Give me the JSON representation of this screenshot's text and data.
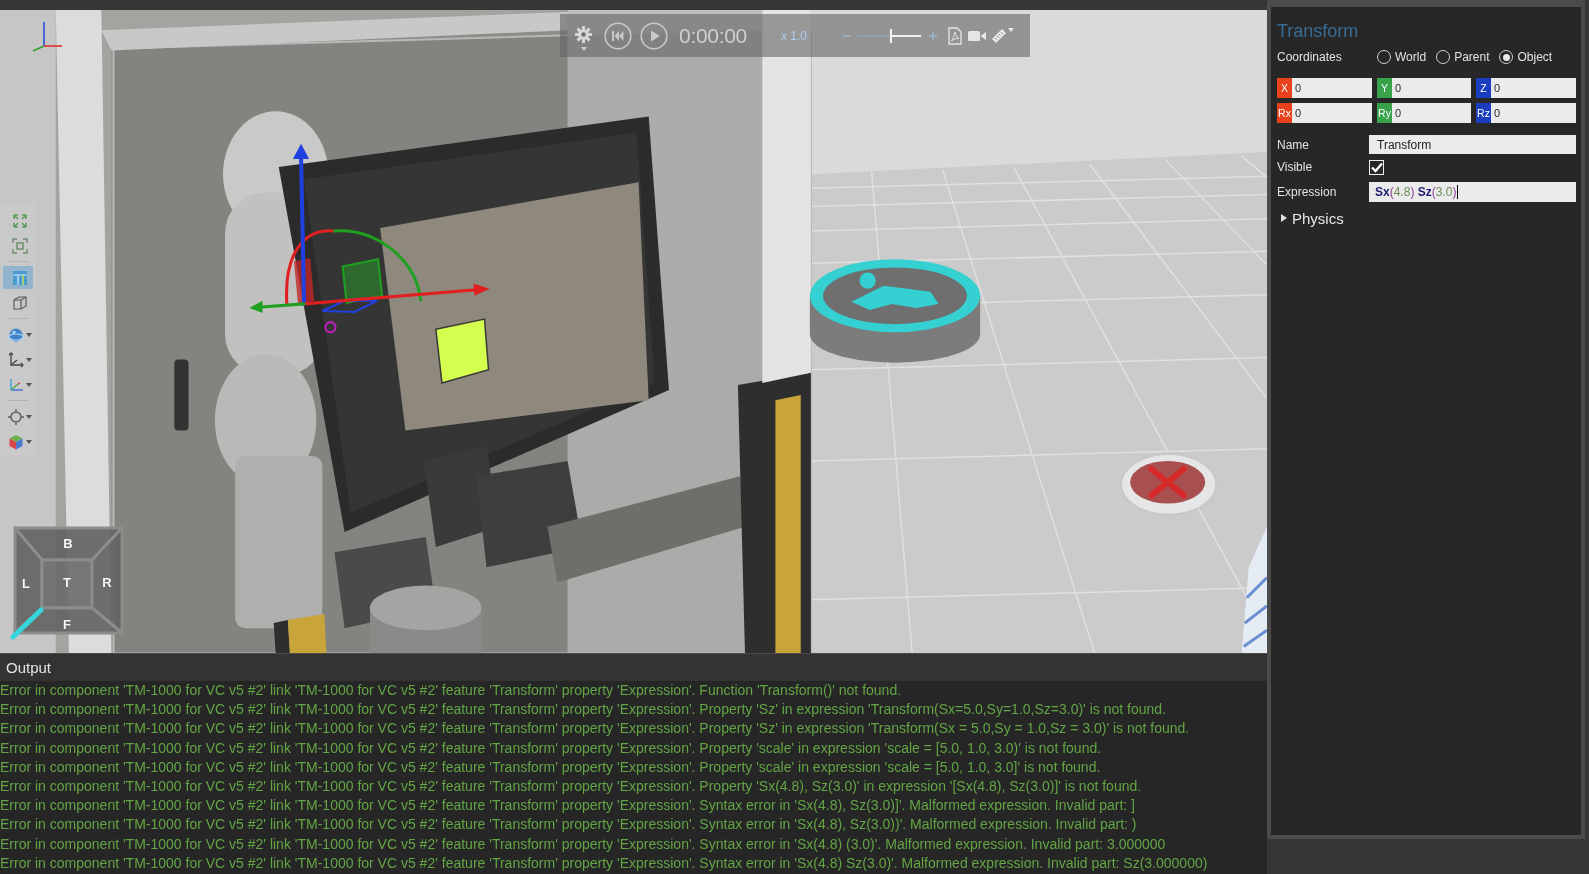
{
  "viewport": {
    "playback_toolbar": {
      "time": "0:00:00",
      "speed": "x 1.0",
      "zoom_slider": {
        "level": 0.53
      }
    },
    "view_toolbar": {
      "groups": [
        {
          "tools": [
            {
              "kind": "fitall",
              "selected": false,
              "has_menu": false
            },
            {
              "kind": "fitframe",
              "selected": false,
              "has_menu": false
            }
          ]
        },
        {
          "tools": [
            {
              "kind": "layout",
              "selected": true,
              "has_menu": false
            },
            {
              "kind": "wireframe",
              "selected": false,
              "has_menu": false
            }
          ]
        },
        {
          "tools": [
            {
              "kind": "sphere",
              "selected": false,
              "has_menu": true
            },
            {
              "kind": "axes",
              "selected": false,
              "has_menu": true
            },
            {
              "kind": "coloraxes",
              "selected": false,
              "has_menu": true
            }
          ]
        },
        {
          "tools": [
            {
              "kind": "snap",
              "selected": false,
              "has_menu": true
            },
            {
              "kind": "cube",
              "selected": false,
              "has_menu": true
            }
          ]
        }
      ]
    },
    "view_cube": {
      "faces": [
        {
          "kind": "upper",
          "label": "B"
        },
        {
          "kind": "left",
          "label": "L"
        },
        {
          "kind": "center",
          "label": "T"
        },
        {
          "kind": "right",
          "label": "R"
        },
        {
          "kind": "lower",
          "label": "F"
        }
      ]
    }
  },
  "properties_panel": {
    "title": "Transform",
    "coordinates": {
      "label": "Coordinates",
      "options": [
        {
          "label": "World",
          "selected": false
        },
        {
          "label": "Parent",
          "selected": false
        },
        {
          "label": "Object",
          "selected": true
        }
      ]
    },
    "position_fields": [
      {
        "label": "X",
        "value": "0",
        "color": "#e8421c"
      },
      {
        "label": "Y",
        "value": "0",
        "color": "#38a34a"
      },
      {
        "label": "Z",
        "value": "0",
        "color": "#1b3ec0"
      }
    ],
    "rotation_fields": [
      {
        "label": "Rx",
        "value": "0",
        "color": "#e8421c"
      },
      {
        "label": "Ry",
        "value": "0",
        "color": "#38a34a"
      },
      {
        "label": "Rz",
        "value": "0",
        "color": "#1b3ec0"
      }
    ],
    "name": {
      "label": "Name",
      "value": "Transform"
    },
    "visible": {
      "label": "Visible",
      "checked": true
    },
    "expression": {
      "label": "Expression",
      "focused": true,
      "tokens": [
        {
          "kind": "name",
          "text": "Sx"
        },
        {
          "kind": "paren",
          "text": "("
        },
        {
          "kind": "number",
          "text": "4.8"
        },
        {
          "kind": "paren",
          "text": ") "
        },
        {
          "kind": "name",
          "text": "Sz"
        },
        {
          "kind": "paren",
          "text": "("
        },
        {
          "kind": "number",
          "text": "3.0"
        },
        {
          "kind": "paren",
          "text": ")"
        }
      ]
    },
    "sections": [
      {
        "label": "Physics",
        "expanded": false
      }
    ]
  },
  "output": {
    "title": "Output",
    "lines": [
      "Error in component 'TM-1000 for VC v5 #2' link 'TM-1000 for VC v5 #2' feature 'Transform' property 'Expression'. Function 'Transform()' not found.",
      "Error in component 'TM-1000 for VC v5 #2' link 'TM-1000 for VC v5 #2' feature 'Transform' property 'Expression'. Property 'Sz' in expression 'Transform(Sx=5.0,Sy=1.0,Sz=3.0)' is not found.",
      "Error in component 'TM-1000 for VC v5 #2' link 'TM-1000 for VC v5 #2' feature 'Transform' property 'Expression'. Property 'Sz' in expression 'Transform(Sx = 5.0,Sy = 1.0,Sz = 3.0)' is not found.",
      "Error in component 'TM-1000 for VC v5 #2' link 'TM-1000 for VC v5 #2' feature 'Transform' property 'Expression'. Property 'scale' in expression 'scale = [5.0, 1.0, 3.0)' is not found.",
      "Error in component 'TM-1000 for VC v5 #2' link 'TM-1000 for VC v5 #2' feature 'Transform' property 'Expression'. Property 'scale' in expression 'scale = [5.0, 1.0, 3.0]' is not found.",
      "Error in component 'TM-1000 for VC v5 #2' link 'TM-1000 for VC v5 #2' feature 'Transform' property 'Expression'. Property 'Sx(4.8), Sz(3.0)' in expression '[Sx(4.8), Sz(3.0)]' is not found.",
      "Error in component 'TM-1000 for VC v5 #2' link 'TM-1000 for VC v5 #2' feature 'Transform' property 'Expression'. Syntax error in 'Sx(4.8), Sz(3.0)]'. Malformed expression. Invalid part: ]",
      "Error in component 'TM-1000 for VC v5 #2' link 'TM-1000 for VC v5 #2' feature 'Transform' property 'Expression'. Syntax error in 'Sx(4.8), Sz(3.0))'. Malformed expression. Invalid part: )",
      "Error in component 'TM-1000 for VC v5 #2' link 'TM-1000 for VC v5 #2' feature 'Transform' property 'Expression'. Syntax error in 'Sx(4.8) (3.0)'. Malformed expression. Invalid part: 3.000000",
      "Error in component 'TM-1000 for VC v5 #2' link 'TM-1000 for VC v5 #2' feature 'Transform' property 'Expression'. Syntax error in 'Sx(4.8) Sz(3.0)'. Malformed expression. Invalid part: Sz(3.000000)"
    ]
  }
}
